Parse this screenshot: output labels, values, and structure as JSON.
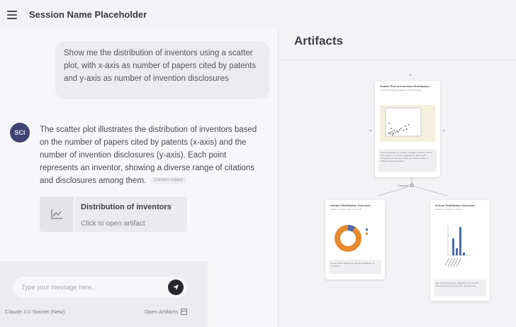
{
  "header": {
    "session_title": "Session Name Placeholder"
  },
  "chat": {
    "user_message": "Show me the distribution of inventors using a scatter plot, with x-axis as number of papers cited by patents and y-axis as number of invention disclosures",
    "assistant_avatar": "SCI",
    "assistant_message": "The scatter plot illustrates the distribution of inventors based on the number of papers cited by patents (x-axis) and the number of invention disclosures (y-axis). Each point represents an inventor, showing a diverse range of citations and disclosures among them.",
    "copy_tag": "Content copied",
    "artifact_card": {
      "title": "Distribution of inventors",
      "subtitle": "Click to open artifact",
      "icon": "chart-icon"
    }
  },
  "composer": {
    "placeholder": "Type your message here...",
    "model": "Claude 3.0 Sonnet (New)",
    "open_artifacts": "Open Artifacts"
  },
  "artifacts": {
    "title": "Artifacts",
    "edge_label": "Connect",
    "nodes": {
      "scatter": {
        "title": "Scatter Plot of Inventors Distribution",
        "subtitle": "Inventors plotted by citations and disclosures",
        "caption": "Inventors plotted by number of papers cited by patents and number of invention disclosures. Each point represents an inventor, showing a diverse range of citations and disclosures."
      },
      "gender": {
        "title": "Gender Distribution Overview",
        "subtitle": "Inventors broken down by gender",
        "caption": "Donut chart showing the gender distribution of inventors."
      },
      "school": {
        "title": "School Distribution Overview",
        "subtitle": "Inventors grouped by school",
        "caption": "Bar chart showing the distribution of inventors across schools and research departments."
      }
    }
  },
  "colors": {
    "avatar": "#3e4372",
    "donut_orange": "#e58a2e",
    "donut_blue": "#4d6aa8",
    "bars_blue": "#4d6aa8"
  }
}
